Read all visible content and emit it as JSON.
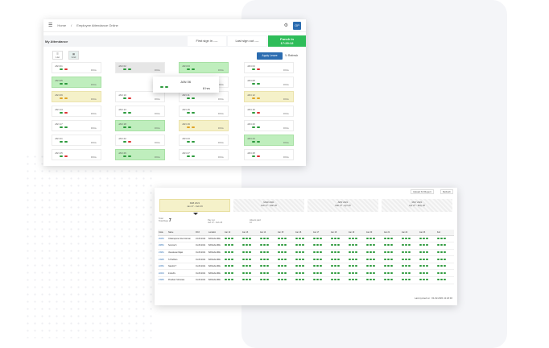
{
  "win1": {
    "breadcrumb_home": "Home",
    "breadcrumb_sep": "/",
    "breadcrumb_page": "Employee Attendance Online",
    "avatar": "OP",
    "section_title": "My Attendance",
    "first_sign_in": "First sign in ----",
    "last_sign_out": "Last sign out ----",
    "punch_label": "Punch In",
    "punch_time": "17:29:12",
    "view_list": "List",
    "view_grid": "Grid",
    "apply_leave": "Apply Leave",
    "refresh": "Refresh",
    "days": [
      {
        "d": "JAN 01",
        "h": "0 hrs",
        "s": ""
      },
      {
        "d": "JAN 02",
        "h": "0 hrs",
        "s": "gr"
      },
      {
        "d": "JAN 03",
        "h": "0 hrs",
        "s": "g"
      },
      {
        "d": "JAN 04",
        "h": "0 hrs",
        "s": ""
      },
      {
        "d": "JAN 05",
        "h": "0 hrs",
        "s": "g"
      },
      {
        "d": "",
        "h": "",
        "s": ""
      },
      {
        "d": "JAN 07",
        "h": "0 hrs",
        "s": ""
      },
      {
        "d": "JAN 08",
        "h": "0 hrs",
        "s": ""
      },
      {
        "d": "JAN 09",
        "h": "0 hrs",
        "s": "y"
      },
      {
        "d": "JAN 10",
        "h": "0 hrs",
        "s": ""
      },
      {
        "d": "JAN 11",
        "h": "0 hrs",
        "s": ""
      },
      {
        "d": "JAN 12",
        "h": "0 hrs",
        "s": "y"
      },
      {
        "d": "JAN 13",
        "h": "0 hrs",
        "s": ""
      },
      {
        "d": "JAN 14",
        "h": "0 hrs",
        "s": ""
      },
      {
        "d": "JAN 15",
        "h": "0 hrs",
        "s": ""
      },
      {
        "d": "JAN 16",
        "h": "0 hrs",
        "s": ""
      },
      {
        "d": "JAN 17",
        "h": "0 hrs",
        "s": ""
      },
      {
        "d": "JAN 18",
        "h": "0 hrs",
        "s": "g"
      },
      {
        "d": "JAN 19",
        "h": "0 hrs",
        "s": "y"
      },
      {
        "d": "JAN 20",
        "h": "0 hrs",
        "s": ""
      },
      {
        "d": "JAN 21",
        "h": "0 hrs",
        "s": ""
      },
      {
        "d": "JAN 22",
        "h": "0 hrs",
        "s": ""
      },
      {
        "d": "JAN 23",
        "h": "0 hrs",
        "s": ""
      },
      {
        "d": "JAN 24",
        "h": "0 hrs",
        "s": "g"
      },
      {
        "d": "JAN 25",
        "h": "0 hrs",
        "s": ""
      },
      {
        "d": "JAN 26",
        "h": "0 hrs",
        "s": "g"
      },
      {
        "d": "JAN 27",
        "h": "0 hrs",
        "s": ""
      },
      {
        "d": "JAN 28",
        "h": "0 hrs",
        "s": ""
      }
    ],
    "popup_day": "JAN 06",
    "popup_hours": "8 hrs"
  },
  "win2": {
    "btn_upload": "Upload Xcl Report",
    "btn_refresh": "Refresh",
    "cards": [
      {
        "t": "FEB 2021",
        "r": "Jan 27 - Feb 26"
      },
      {
        "t": "MAR 2021",
        "r": "Feb 27 - Mar 26"
      },
      {
        "t": "APR 2021",
        "r": "Mar 27 - Apr 26"
      },
      {
        "t": "MAY 2021",
        "r": "Apr 27 - May 26"
      }
    ],
    "stat1_label": "Total",
    "stat1_sub": "Total Days",
    "stat1_value": "7",
    "stat2_label": "Pay cut",
    "stat2_value": "Jan 27 - Feb 26",
    "stat3_label": "Absent paid",
    "stat3_value": "10",
    "columns": [
      "Code",
      "Name",
      "DOJ",
      "Location",
      "Jan 12",
      "Jan 13",
      "Jan 14",
      "Jan 15",
      "Jan 16",
      "Jan 17",
      "Jan 18",
      "Jan 19",
      "Jan 20",
      "Jan 21",
      "Jan 22",
      "Jan 23",
      "Feb"
    ],
    "rows": [
      {
        "code": "26453",
        "name": "Chakraponte Siva Varman",
        "doj": "23-05-2022",
        "loc": "BANGALORE"
      },
      {
        "code": "20881",
        "name": "Soumia S",
        "doj": "01-05-2021",
        "loc": "BANGALORE"
      },
      {
        "code": "21961",
        "name": "Vasudevan Rajat",
        "doj": "01-05-2021",
        "loc": "BANGALORE"
      },
      {
        "code": "21995",
        "name": "S Prabhan",
        "doj": "01-05-2021",
        "loc": "BANGALORE"
      },
      {
        "code": "22381",
        "name": "Nandini T",
        "doj": "01-05-2021",
        "loc": "BANGALORE"
      },
      {
        "code": "22404",
        "name": "Indushiv",
        "doj": "01-05-2021",
        "loc": "BANGALORE"
      },
      {
        "code": "21983",
        "name": "Prasham Srinivasa",
        "doj": "01-05-2021",
        "loc": "BANGALORE"
      }
    ],
    "footer": "Last synced on : 01-02-2021 11:22:16"
  }
}
